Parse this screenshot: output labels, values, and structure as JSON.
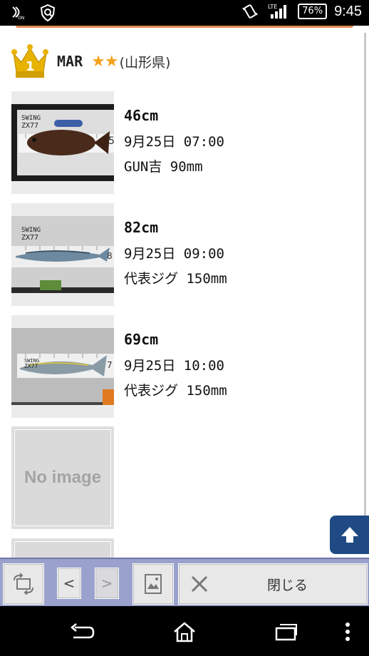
{
  "status_bar": {
    "icons_left": [
      "nfc-icon",
      "shield-icon"
    ],
    "icons_right": [
      "vibrate-icon",
      "signal-lte-icon"
    ],
    "network": "LTE",
    "battery": "76%",
    "time": "9:45"
  },
  "header": {
    "rank_icon": "crown-rank-1-icon",
    "rank": "1",
    "username": "MAR",
    "stars": "★★",
    "prefecture": "(山形県)"
  },
  "entries": [
    {
      "size": "46cm",
      "datetime": "9月25日 07:00",
      "lure": "GUN吉 90mm"
    },
    {
      "size": "82cm",
      "datetime": "9月25日 09:00",
      "lure": "代表ジグ 150mm"
    },
    {
      "size": "69cm",
      "datetime": "9月25日 10:00",
      "lure": "代表ジグ 150mm"
    }
  ],
  "no_image_label": "No image",
  "toolbar": {
    "rotate_icon": "rotate-screen-icon",
    "prev_label": "<",
    "next_label": ">",
    "gallery_icon": "image-icon",
    "close_icon": "close-x-icon",
    "close_label": "閉じる"
  },
  "nav_bar": {
    "back_icon": "back-icon",
    "home_icon": "home-icon",
    "recents_icon": "recent-apps-icon",
    "menu_icon": "overflow-menu-icon"
  },
  "colors": {
    "accent_orange": "#e58a57",
    "star": "#f5a11c",
    "crown": "#e8b200",
    "toolbar": "#9aa1cc",
    "scroll_top_button": "#1f4a83"
  }
}
